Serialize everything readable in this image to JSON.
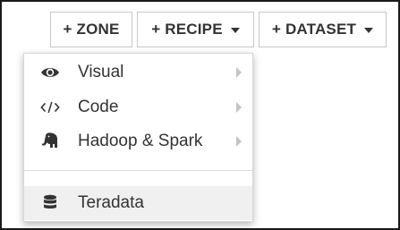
{
  "toolbar": {
    "zone_label": "+ ZONE",
    "recipe_label": "+ RECIPE",
    "dataset_label": "+ DATASET"
  },
  "recipe_menu": {
    "items": [
      {
        "label": "Visual",
        "icon": "eye-icon",
        "has_submenu": true
      },
      {
        "label": "Code",
        "icon": "code-icon",
        "has_submenu": true
      },
      {
        "label": "Hadoop & Spark",
        "icon": "elephant-icon",
        "has_submenu": true
      },
      {
        "label": "Teradata",
        "icon": "database-icon",
        "has_submenu": false
      }
    ]
  },
  "colors": {
    "text": "#333333",
    "border": "#c8c8c8",
    "hover_bg": "#f0f0f0",
    "chevron": "#c4c4c4"
  }
}
